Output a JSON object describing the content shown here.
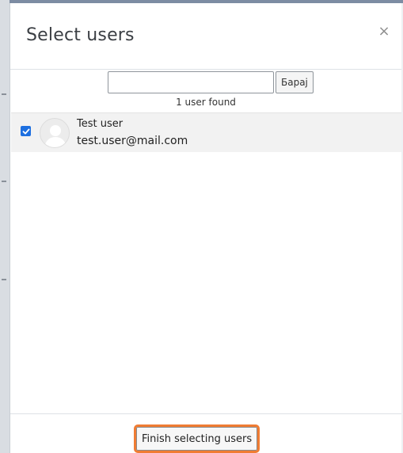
{
  "dialog": {
    "title": "Select users",
    "close_label": "×"
  },
  "search": {
    "value": "",
    "placeholder": "",
    "button_label": "Барај"
  },
  "results": {
    "count_text": "1 user found"
  },
  "users": [
    {
      "name": "Test user",
      "email": "test.user@mail.com",
      "selected": true
    }
  ],
  "footer": {
    "finish_label": "Finish selecting users"
  },
  "icons": {
    "avatar": "user-avatar-icon",
    "checkbox": "checkbox-checked-icon",
    "close": "close-icon"
  },
  "colors": {
    "checkbox": "#1d6fe0",
    "highlight": "#f07c33",
    "title_text": "#3b3f44"
  }
}
